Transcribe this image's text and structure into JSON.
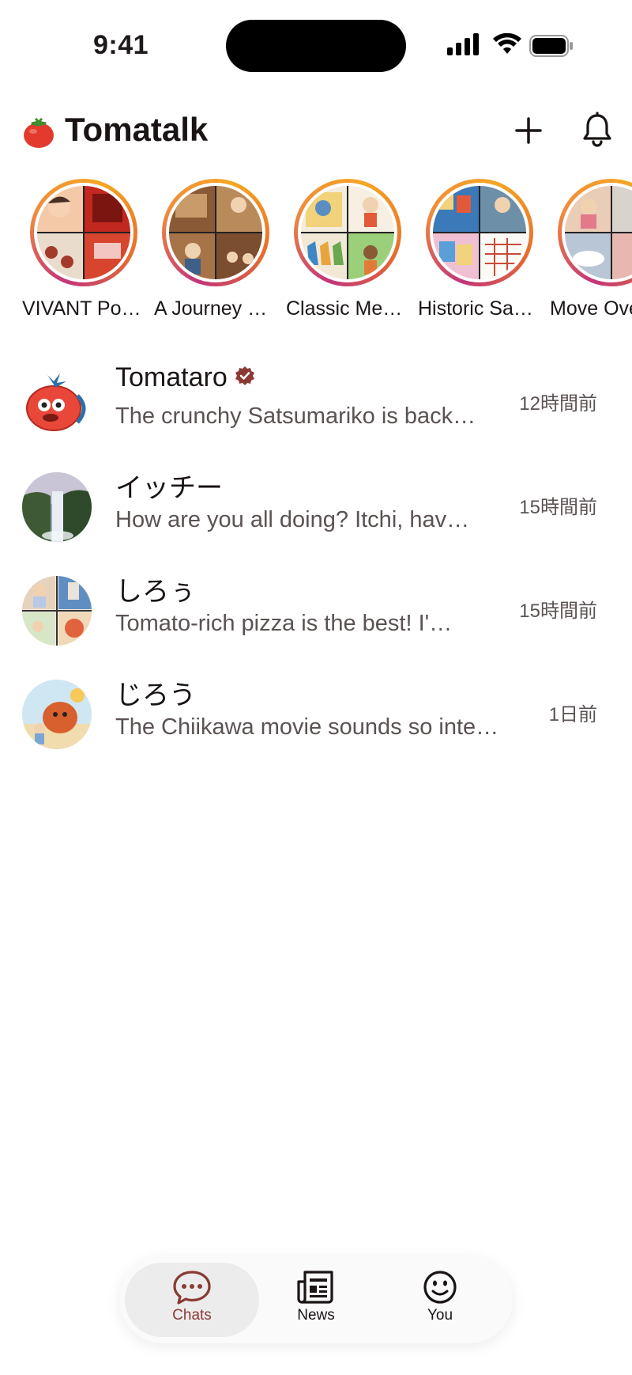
{
  "status_bar": {
    "time": "9:41"
  },
  "header": {
    "title": "Tomatalk"
  },
  "stories": [
    {
      "label": "VIVANT Po…"
    },
    {
      "label": "A Journey …"
    },
    {
      "label": "Classic Me…"
    },
    {
      "label": "Historic Sa…"
    },
    {
      "label": "Move Ove"
    }
  ],
  "chats": [
    {
      "name": "Tomataro",
      "verified": true,
      "preview": "The crunchy Satsumariko is back…",
      "time": "12時間前"
    },
    {
      "name": "イッチー",
      "preview": "How are you all doing? Itchi, hav…",
      "time": "15時間前"
    },
    {
      "name": "しろぅ",
      "preview": "Tomato-rich pizza is the best! I'…",
      "time": "15時間前"
    },
    {
      "name": "じろう",
      "preview": "The Chiikawa movie sounds so inte…",
      "time": "1日前"
    }
  ],
  "nav": {
    "items": [
      {
        "label": "Chats",
        "active": true
      },
      {
        "label": "News"
      },
      {
        "label": "You"
      }
    ]
  },
  "colors": {
    "accent": "#8a3b35",
    "ring_start": "#c2357a",
    "ring_end": "#f5a623"
  }
}
